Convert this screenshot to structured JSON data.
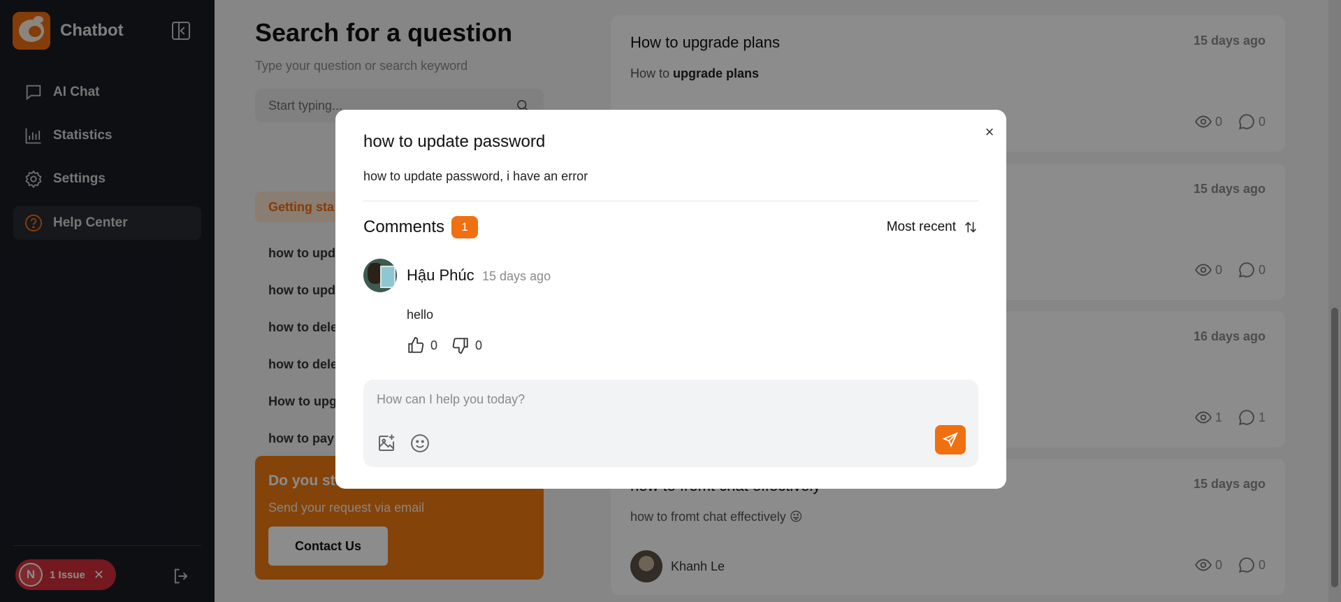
{
  "app": {
    "name": "Chatbot"
  },
  "sidebar": {
    "items": [
      {
        "label": "AI Chat",
        "icon": "chat-icon"
      },
      {
        "label": "Statistics",
        "icon": "chart-icon"
      },
      {
        "label": "Settings",
        "icon": "gear-icon"
      },
      {
        "label": "Help Center",
        "icon": "help-icon",
        "active": true
      }
    ],
    "issue": {
      "avatar": "N",
      "label": "1 Issue",
      "close": "✕"
    }
  },
  "search": {
    "title": "Search for a question",
    "subtitle": "Type your question or search keyword",
    "placeholder": "Start typing..."
  },
  "categories": {
    "active": "Getting sta"
  },
  "questions": [
    "how to upd",
    "how to upd",
    "how to dele",
    "how to dele",
    "How to upg",
    "how to pay"
  ],
  "promo": {
    "title": "Do you sti",
    "subtitle": "Send your request via email",
    "button": "Contact Us"
  },
  "cards": [
    {
      "title": "How to upgrade plans",
      "desc_prefix": "How to ",
      "desc_bold": "upgrade plans",
      "time": "15 days ago",
      "views": "0",
      "comments": "0"
    },
    {
      "time": "15 days ago",
      "views": "0",
      "comments": "0"
    },
    {
      "time": "16 days ago",
      "views": "1",
      "comments": "1"
    },
    {
      "title": "how to fromt chat effectively",
      "desc": "how to fromt chat effectively 😜",
      "time": "15 days ago",
      "author": "Khanh Le",
      "views": "0",
      "comments": "0"
    }
  ],
  "modal": {
    "title": "how to update password",
    "description": "how to update password, i have an error",
    "close": "×",
    "comments_label": "Comments",
    "comments_count": "1",
    "sort_label": "Most recent",
    "comment": {
      "author": "Hậu Phúc",
      "time": "15 days ago",
      "body": "hello",
      "likes": "0",
      "dislikes": "0"
    },
    "composer_placeholder": "How can I help you today?"
  },
  "colors": {
    "accent": "#f06f11",
    "sidebar_bg": "#1a1c24",
    "danger": "#d32f3a"
  }
}
